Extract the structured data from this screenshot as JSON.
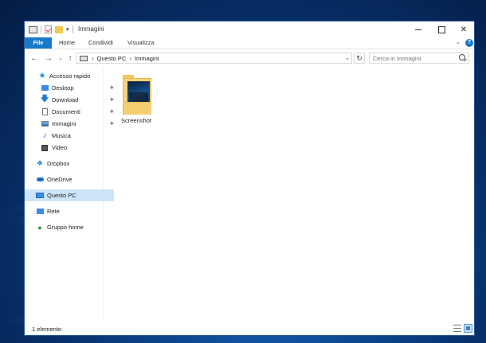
{
  "window": {
    "title": "Immagini",
    "ribbon_tabs": [
      "File",
      "Home",
      "Condividi",
      "Visualizza"
    ]
  },
  "address": {
    "segments": [
      "Questo PC",
      "Immagini"
    ]
  },
  "search": {
    "placeholder": "Cerca in Immagini"
  },
  "sidebar": {
    "quick_access": "Accesso rapido",
    "quick_items": [
      "Desktop",
      "Download",
      "Documenti",
      "Immagini",
      "Musica",
      "Video"
    ],
    "dropbox": "Dropbox",
    "onedrive": "OneDrive",
    "this_pc": "Questo PC",
    "network": "Rete",
    "homegroup": "Gruppo home"
  },
  "content": {
    "items": [
      {
        "name": "Screenshot",
        "icon": "folder-icon"
      }
    ]
  },
  "status": {
    "count": "1 elemento"
  },
  "colors": {
    "accent": "#1979ca",
    "selection": "#cce4f7"
  }
}
